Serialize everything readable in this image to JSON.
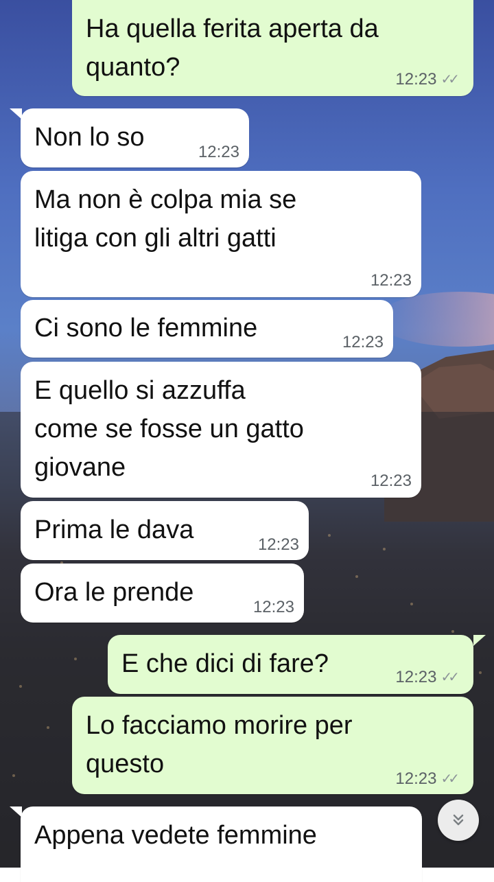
{
  "messages": [
    {
      "direction": "out",
      "text": "Ha quella ferita aperta da\nquanto?",
      "time": "12:23",
      "read": true
    },
    {
      "direction": "in",
      "text": "Non lo so",
      "time": "12:23"
    },
    {
      "direction": "in",
      "text": "Ma non è colpa mia se\nlitiga con gli altri gatti",
      "time": "12:23"
    },
    {
      "direction": "in",
      "text": "Ci sono le femmine",
      "time": "12:23"
    },
    {
      "direction": "in",
      "text": "E quello si azzuffa\ncome se fosse un gatto\ngiovane",
      "time": "12:23"
    },
    {
      "direction": "in",
      "text": "Prima le dava",
      "time": "12:23"
    },
    {
      "direction": "in",
      "text": "Ora le prende",
      "time": "12:23"
    },
    {
      "direction": "out",
      "text": "E che dici di fare?",
      "time": "12:23",
      "read": true
    },
    {
      "direction": "out",
      "text": "Lo facciamo morire per\nquesto",
      "time": "12:23",
      "read": true
    },
    {
      "direction": "in",
      "text": "Appena vedete femmine",
      "time": ""
    }
  ],
  "scroll_button": {
    "icon": "double-chevron-down-icon"
  },
  "colors": {
    "incoming_bubble": "#ffffff",
    "outgoing_bubble": "#e2fcd0",
    "read_ticks": "#8c9498"
  }
}
